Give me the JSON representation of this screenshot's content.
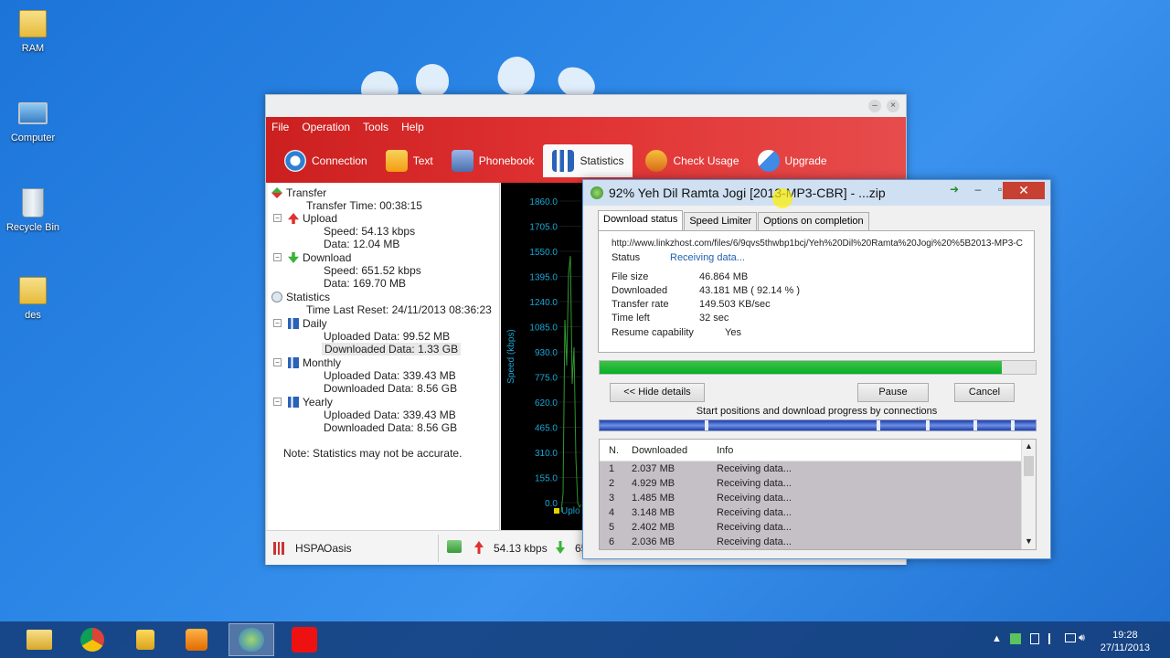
{
  "desktop": {
    "icons": [
      {
        "label": "RAM",
        "icon": "user-folder-icon"
      },
      {
        "label": "Computer",
        "icon": "computer-icon"
      },
      {
        "label": "Recycle Bin",
        "icon": "recycle-bin-icon"
      },
      {
        "label": "des",
        "icon": "folder-icon"
      }
    ]
  },
  "modem": {
    "menu": [
      "File",
      "Operation",
      "Tools",
      "Help"
    ],
    "tabs": [
      {
        "label": "Connection",
        "icon": "connection-icon"
      },
      {
        "label": "Text",
        "icon": "text-envelope-icon"
      },
      {
        "label": "Phonebook",
        "icon": "phonebook-icon"
      },
      {
        "label": "Statistics",
        "icon": "statistics-icon"
      },
      {
        "label": "Check Usage",
        "icon": "check-usage-icon"
      },
      {
        "label": "Upgrade",
        "icon": "upgrade-icon"
      }
    ],
    "active_tab": "Statistics",
    "tree": {
      "transfer": "Transfer",
      "transfer_time": "Transfer Time: 00:38:15",
      "upload": "Upload",
      "upload_speed": "Speed: 54.13 kbps",
      "upload_data": "Data: 12.04 MB",
      "download": "Download",
      "download_speed": "Speed: 651.52 kbps",
      "download_data": "Data: 169.70 MB",
      "statistics": "Statistics",
      "time_last_reset": "Time Last Reset: 24/11/2013 08:36:23",
      "daily": "Daily",
      "daily_up": "Uploaded Data: 99.52 MB",
      "daily_down": "Downloaded Data: 1.33 GB",
      "monthly": "Monthly",
      "monthly_up": "Uploaded Data: 339.43 MB",
      "monthly_down": "Downloaded Data: 8.56 GB",
      "yearly": "Yearly",
      "yearly_up": "Uploaded Data: 339.43 MB",
      "yearly_down": "Downloaded Data: 8.56 GB",
      "note": "Note: Statistics may not be accurate."
    },
    "graph": {
      "ylabel": "Speed (kbps)",
      "ticks": [
        "1860.0",
        "1705.0",
        "1550.0",
        "1395.0",
        "1240.0",
        "1085.0",
        "930.0",
        "775.0",
        "620.0",
        "465.0",
        "310.0",
        "155.0",
        "0.0"
      ],
      "legend": "Uplo"
    },
    "status": {
      "network": "HSPA",
      "operator": "Oasis",
      "upload_speed": "54.13 kbps",
      "download_speed_partial": "65"
    },
    "colors": {
      "header_red": "#e13333",
      "graph_line": "#2e9a2e",
      "axis_text": "#19a7d6"
    }
  },
  "idm": {
    "title": "92% Yeh Dil Ramta Jogi [2013-MP3-CBR] - ...zip",
    "tabs": [
      "Download status",
      "Speed Limiter",
      "Options on completion"
    ],
    "url": "http://www.linkzhost.com/files/6/9qvs5thwbp1bcj/Yeh%20Dil%20Ramta%20Jogi%20%5B2013-MP3-C",
    "status_label": "Status",
    "status_value": "Receiving data...",
    "file_size_label": "File size",
    "file_size": "46.864  MB",
    "downloaded_label": "Downloaded",
    "downloaded": "43.181  MB  ( 92.14 % )",
    "transfer_rate_label": "Transfer rate",
    "transfer_rate": "149.503  KB/sec",
    "time_left_label": "Time left",
    "time_left": "32 sec",
    "resume_label": "Resume capability",
    "resume": "Yes",
    "progress_fraction": 0.9214,
    "hide_details": "<< Hide details",
    "pause": "Pause",
    "cancel": "Cancel",
    "connections_label": "Start positions and download progress by connections",
    "columns": [
      "N.",
      "Downloaded",
      "Info"
    ],
    "connections": [
      {
        "n": "1",
        "downloaded": "2.037  MB",
        "info": "Receiving data..."
      },
      {
        "n": "2",
        "downloaded": "4.929  MB",
        "info": "Receiving data..."
      },
      {
        "n": "3",
        "downloaded": "1.485  MB",
        "info": "Receiving data..."
      },
      {
        "n": "4",
        "downloaded": "3.148  MB",
        "info": "Receiving data..."
      },
      {
        "n": "5",
        "downloaded": "2.402  MB",
        "info": "Receiving data..."
      },
      {
        "n": "6",
        "downloaded": "2.036  MB",
        "info": "Receiving data..."
      }
    ]
  },
  "taskbar": {
    "items": [
      "file-explorer-icon",
      "chrome-icon",
      "lock-icon",
      "media-player-icon",
      "idm-icon",
      "airtel-icon"
    ],
    "time": "19:28",
    "date": "27/11/2013"
  }
}
